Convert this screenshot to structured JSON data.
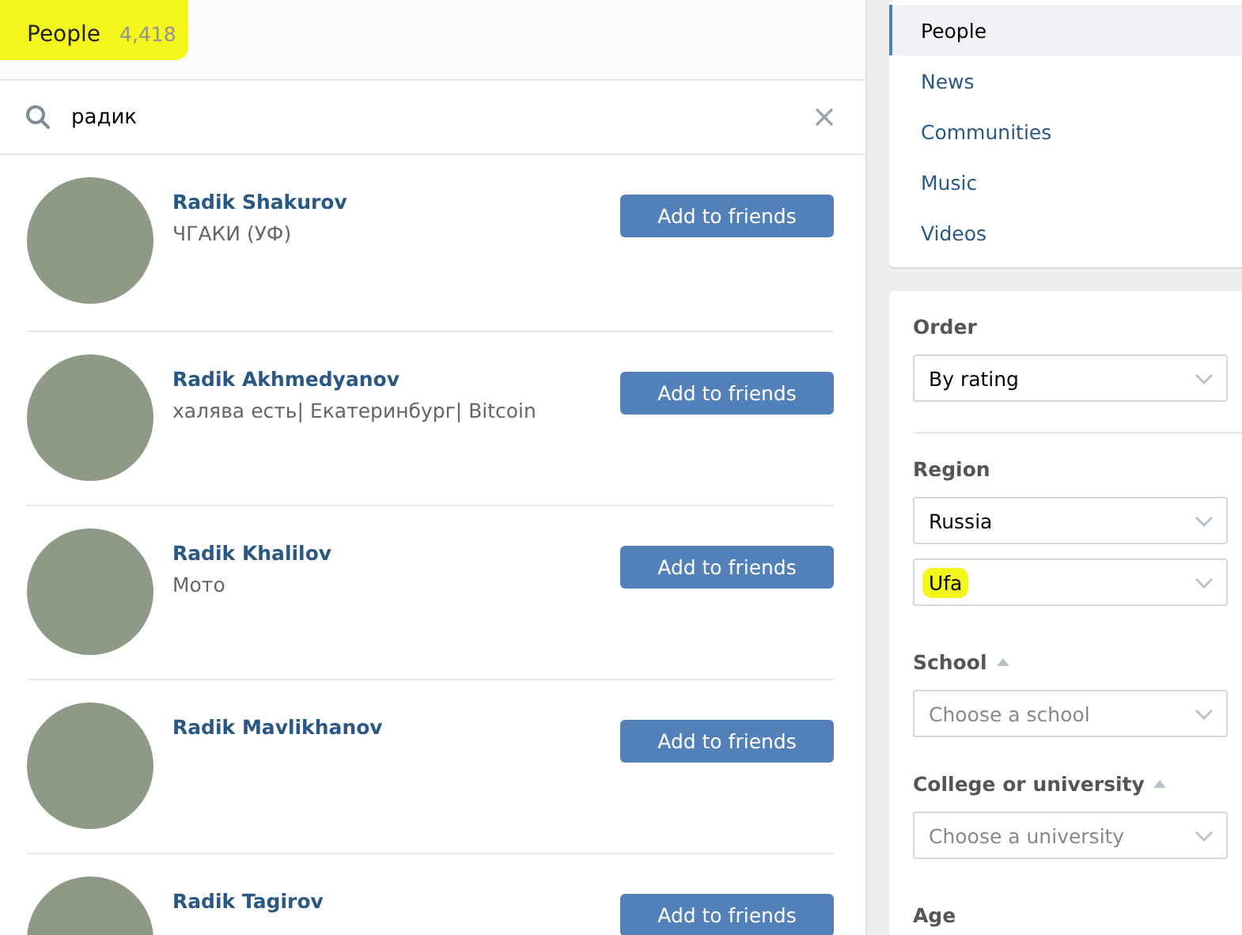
{
  "header": {
    "title": "People",
    "count": "4,418",
    "highlighted": true
  },
  "search": {
    "value": "радик"
  },
  "results": [
    {
      "name": "Radik Shakurov",
      "info": "ЧГАКИ (УФ)",
      "button": "Add to friends"
    },
    {
      "name": "Radik Akhmedyanov",
      "info": "халява есть| Екатеринбург| Bitcoin",
      "button": "Add to friends"
    },
    {
      "name": "Radik Khalilov",
      "info": "Мото",
      "button": "Add to friends"
    },
    {
      "name": "Radik Mavlikhanov",
      "button": "Add to friends"
    },
    {
      "name": "Radik Tagirov",
      "button": "Add to friends"
    }
  ],
  "nav": [
    {
      "label": "People",
      "selected": true
    },
    {
      "label": "News",
      "selected": false
    },
    {
      "label": "Communities",
      "selected": false
    },
    {
      "label": "Music",
      "selected": false
    },
    {
      "label": "Videos",
      "selected": false
    }
  ],
  "filters": [
    {
      "label": "Order",
      "expandable": false,
      "selects": [
        {
          "value": "By rating",
          "highlighted": false
        }
      ]
    },
    {
      "label": "Region",
      "expandable": false,
      "selects": [
        {
          "value": "Russia",
          "highlighted": false
        },
        {
          "value": "Ufa",
          "highlighted": true
        }
      ]
    },
    {
      "label": "School",
      "expandable": true,
      "selects": [
        {
          "placeholder": "Choose a school"
        }
      ]
    },
    {
      "label": "College or university",
      "expandable": true,
      "selects": [
        {
          "placeholder": "Choose a university"
        }
      ]
    },
    {
      "label": "Age",
      "expandable": false
    }
  ]
}
